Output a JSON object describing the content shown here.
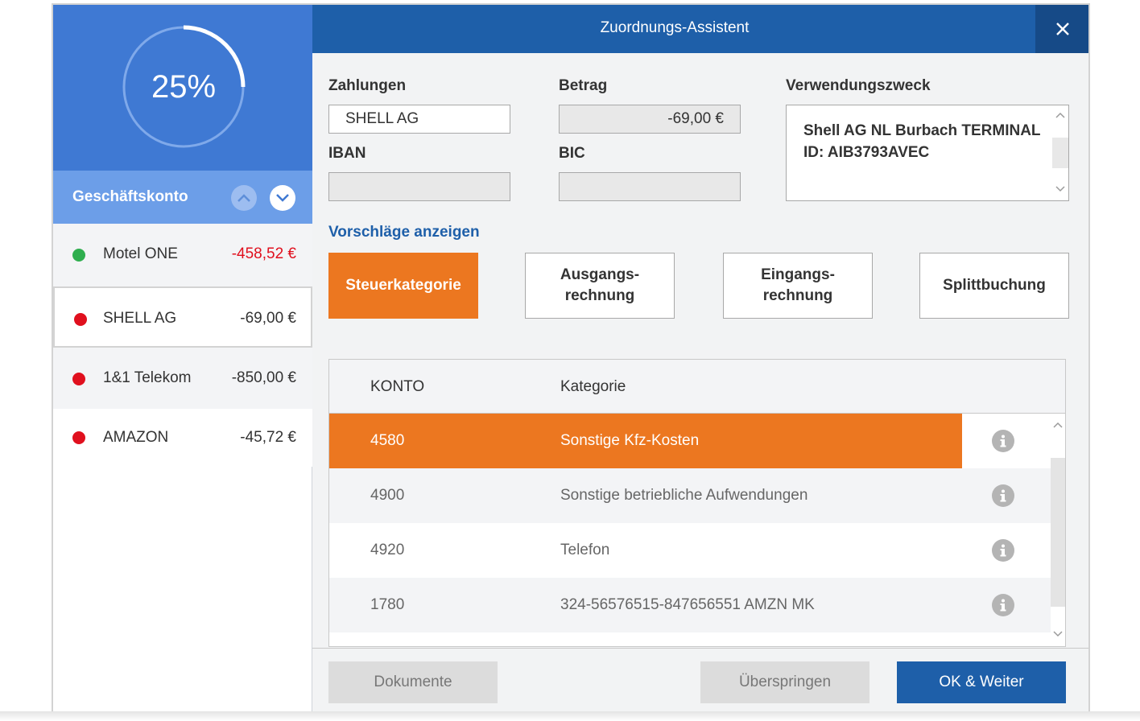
{
  "progress": {
    "percent_label": "25%",
    "fraction": 0.25
  },
  "sidebar": {
    "account_label": "Geschäftskonto",
    "transactions": [
      {
        "name": "Motel ONE",
        "amount": "-458,52 €",
        "status_color": "#2fae4e",
        "amount_color": "#e0101e"
      },
      {
        "name": "SHELL AG",
        "amount": "-69,00 €",
        "status_color": "#e0101e",
        "amount_color": "#333333"
      },
      {
        "name": "1&1 Telekom",
        "amount": "-850,00 €",
        "status_color": "#e0101e",
        "amount_color": "#333333"
      },
      {
        "name": "AMAZON",
        "amount": "-45,72 €",
        "status_color": "#e0101e",
        "amount_color": "#333333"
      }
    ]
  },
  "dialog": {
    "title": "Zuordnungs-Assistent",
    "labels": {
      "payments": "Zahlungen",
      "amount": "Betrag",
      "purpose": "Verwendungszweck",
      "iban": "IBAN",
      "bic": "BIC"
    },
    "values": {
      "payments": "SHELL AG",
      "amount": "-69,00 €",
      "iban": "",
      "bic": "",
      "purpose": "Shell AG NL Burbach TERMINAL ID: AIB3793AVEC"
    },
    "show_suggestions": "Vorschläge anzeigen",
    "category_buttons": [
      "Steuerkategorie",
      "Ausgangs-\nrechnung",
      "Eingangs-\nrechnung",
      "Splittbuchung"
    ],
    "table": {
      "headers": [
        "KONTO",
        "Kategorie"
      ],
      "rows": [
        {
          "konto": "4580",
          "kategorie": "Sonstige Kfz-Kosten"
        },
        {
          "konto": "4900",
          "kategorie": "Sonstige betriebliche Aufwendungen"
        },
        {
          "konto": "4920",
          "kategorie": "Telefon"
        },
        {
          "konto": "1780",
          "kategorie": "324-56576515-847656551 AMZN MK"
        }
      ]
    },
    "footer": {
      "documents": "Dokumente",
      "skip": "Überspringen",
      "ok_next": "OK & Weiter"
    }
  },
  "colors": {
    "accent_orange": "#ec7720",
    "primary_blue": "#1e5fa9",
    "progress_blue": "#3f79d3"
  },
  "icons": [
    "close-icon",
    "chevron-up-icon",
    "chevron-down-icon",
    "info-icon"
  ]
}
